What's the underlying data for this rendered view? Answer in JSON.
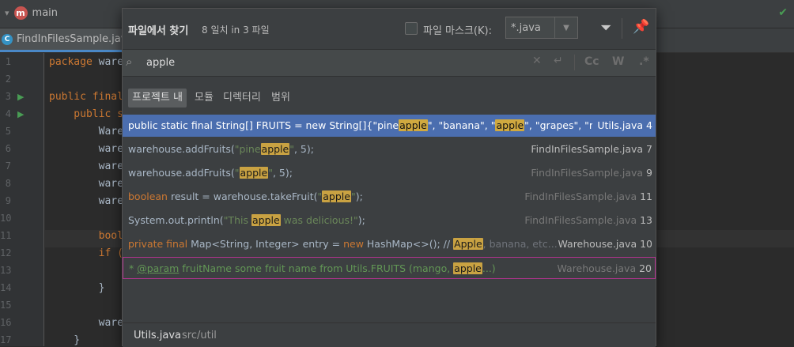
{
  "top": {
    "branch_label": "main",
    "branch_badge": "m"
  },
  "tab": {
    "file_name": "FindInFilesSample.java",
    "badge": "C"
  },
  "editor": {
    "line_numbers": [
      "1",
      "2",
      "3",
      "4",
      "5",
      "6",
      "7",
      "8",
      "9",
      "10",
      "11",
      "12",
      "13",
      "14",
      "15",
      "16",
      "17"
    ],
    "lines": [
      {
        "kw": "package",
        "text": " ware"
      },
      {
        "kw": "",
        "text": ""
      },
      {
        "kw": "public final",
        "text": ""
      },
      {
        "kw": "    public s",
        "text": ""
      },
      {
        "kw": "",
        "text": "        Ware"
      },
      {
        "kw": "",
        "text": "        ware"
      },
      {
        "kw": "",
        "text": "        ware"
      },
      {
        "kw": "",
        "text": "        ware"
      },
      {
        "kw": "",
        "text": "        ware"
      },
      {
        "kw": "",
        "text": ""
      },
      {
        "kw": "        bool",
        "text": ""
      },
      {
        "kw": "        if (",
        "text": ""
      },
      {
        "kw": "",
        "text": ""
      },
      {
        "kw": "",
        "text": "        }"
      },
      {
        "kw": "",
        "text": ""
      },
      {
        "kw": "",
        "text": "        ware"
      },
      {
        "kw": "",
        "text": "    }"
      }
    ]
  },
  "popup": {
    "title": "파일에서 찾기",
    "count": "8 일치 in 3 파일",
    "mask_label": "파일 마스크(K):",
    "mask_value": "*.java",
    "search_value": "apple",
    "opt_case": "Cc",
    "opt_word": "W",
    "opt_regex": ".*",
    "scopes": [
      "프로젝트 내",
      "모듈",
      "디렉터리",
      "범위"
    ],
    "results": [
      {
        "pre": "public static final String[] FRUITS = new String[]{\"pine",
        "match": "apple",
        "post": "\", \"banana\", \"",
        "match2": "apple",
        "post2": "\", \"grapes\", \"mar",
        "file": "Utils.java",
        "line": "4"
      },
      {
        "pre": "warehouse.addFruits(",
        "str1": "\"pine",
        "match": "apple",
        "str2": "\"",
        "post": ", 5);",
        "file": "FindInFilesSample.java",
        "line": "7"
      },
      {
        "pre": "warehouse.addFruits(",
        "str1": "\"",
        "match": "apple",
        "str2": "\"",
        "post": ", 5);",
        "file": "FindInFilesSample.java",
        "line": "9"
      },
      {
        "kw": "boolean",
        "pre": " result = warehouse.takeFruit(",
        "str1": "\"",
        "match": "apple",
        "str2": "\"",
        "post": ");",
        "file": "FindInFilesSample.java",
        "line": "11"
      },
      {
        "pre": "System.out.println(",
        "str1": "\"This ",
        "match": "apple",
        "str2": " was delicious!\"",
        "post": ");",
        "file": "FindInFilesSample.java",
        "line": "13"
      },
      {
        "kw": "private final",
        "pre": " Map<String, Integer> entry = ",
        "kw2": "new",
        "pre2": " HashMap<>(); // ",
        "match": "Apple",
        "post": ", banana, etc...",
        "file": "Warehouse.java",
        "line": "10"
      },
      {
        "pre": "* ",
        "tag": "@param",
        "post": " fruitName some fruit name from Utils.FRUITS (mango, ",
        "match": "apple",
        "post2": "...)",
        "file": "Warehouse.java",
        "line": "20"
      }
    ],
    "footer_file": "Utils.java",
    "footer_path": "src/util"
  }
}
